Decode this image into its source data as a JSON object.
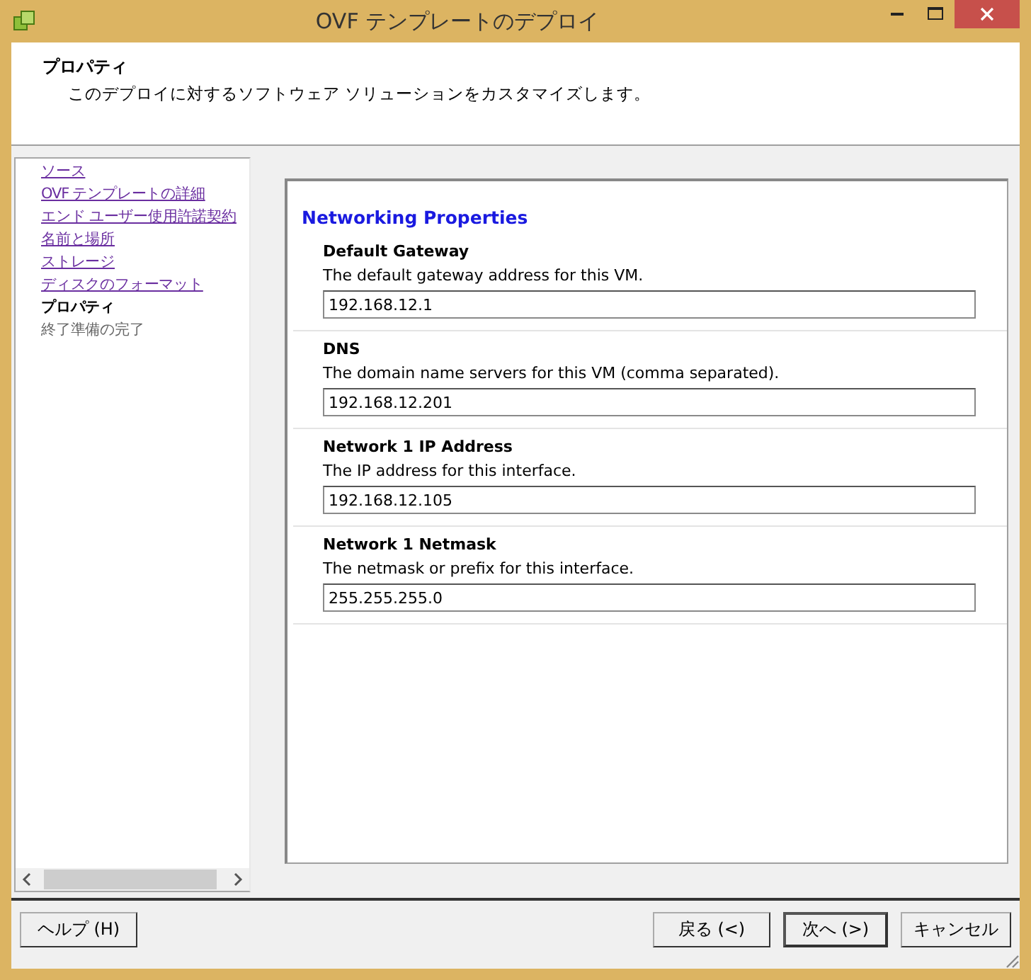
{
  "window": {
    "title": "OVF テンプレートのデプロイ"
  },
  "header": {
    "title": "プロパティ",
    "description": "このデプロイに対するソフトウェア ソリューションをカスタマイズします。"
  },
  "nav": {
    "items": [
      {
        "label": "ソース",
        "kind": "link"
      },
      {
        "label": "OVF テンプレートの詳細",
        "kind": "link"
      },
      {
        "label": "エンド ユーザー使用許諾契約",
        "kind": "link"
      },
      {
        "label": "名前と場所",
        "kind": "link"
      },
      {
        "label": "ストレージ",
        "kind": "link"
      },
      {
        "label": "ディスクのフォーマット",
        "kind": "link"
      },
      {
        "label": "プロパティ",
        "kind": "current"
      },
      {
        "label": "終了準備の完了",
        "kind": "pending"
      }
    ]
  },
  "properties": {
    "title": "Networking Properties",
    "fields": [
      {
        "label": "Default Gateway",
        "description": "The default gateway address for this VM.",
        "value": "192.168.12.1"
      },
      {
        "label": "DNS",
        "description": "The domain name servers for this VM (comma separated).",
        "value": "192.168.12.201"
      },
      {
        "label": "Network 1 IP Address",
        "description": "The IP address for this interface.",
        "value": "192.168.12.105"
      },
      {
        "label": "Network 1 Netmask",
        "description": "The netmask or prefix for this interface.",
        "value": "255.255.255.0"
      }
    ]
  },
  "buttons": {
    "left": [
      {
        "label": "ヘルプ (H)",
        "default": false
      }
    ],
    "right": [
      {
        "label": "戻る (<)",
        "default": false
      },
      {
        "label": "次へ (>)",
        "default": true
      },
      {
        "label": "キャンセル",
        "default": false
      }
    ]
  }
}
